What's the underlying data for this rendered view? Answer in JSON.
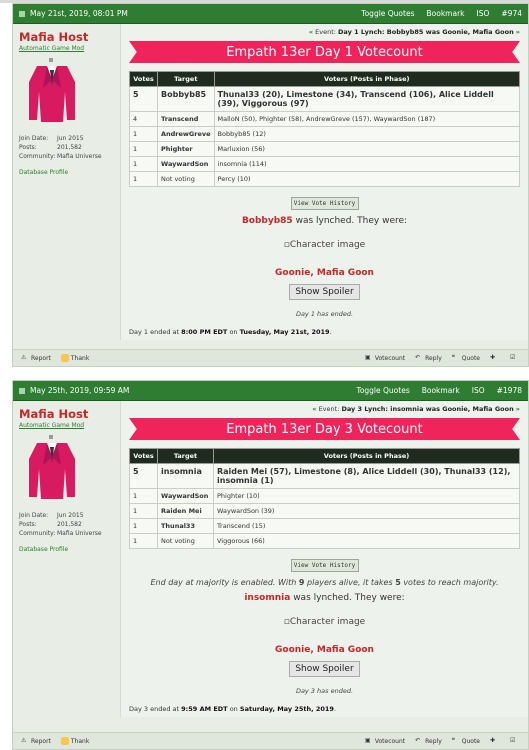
{
  "posts": [
    {
      "date": "May 21st, 2019, 08:01 PM",
      "toggle_quotes": "Toggle Quotes",
      "bookmark": "Bookmark",
      "iso": "ISO",
      "post_number": "#974",
      "user": {
        "name": "Mafia Host",
        "title": "Automatic Game Mod",
        "join_date_label": "Join Date:",
        "join_date": "Jun 2015",
        "posts_label": "Posts:",
        "posts": "201,582",
        "community_label": "Community:",
        "community": "Mafia Universe",
        "db_profile": "Database Profile"
      },
      "event_prefix": "Event:",
      "event": "Day 1 Lynch: Bobbyb85 was Goonie, Mafia Goon",
      "banner": "Empath 13er Day 1 Votecount",
      "table_headers": [
        "Votes",
        "Target",
        "Voters (Posts in Phase)"
      ],
      "rows": [
        {
          "votes": "5",
          "target": "Bobbyb85",
          "voters": "Thunal33 (20), Limestone (34), Transcend (106), Alice Liddell (39), Viggorous (97)"
        },
        {
          "votes": "4",
          "target": "Transcend",
          "voters": "MalloN (50), Phighter (58), AndrewGreve (157), WaywardSon (187)"
        },
        {
          "votes": "1",
          "target": "AndrewGreve",
          "voters": "Bobbyb85 (12)"
        },
        {
          "votes": "1",
          "target": "Phighter",
          "voters": "Marluxion (56)"
        },
        {
          "votes": "1",
          "target": "WaywardSon",
          "voters": "insomnia (114)"
        },
        {
          "votes": "1",
          "target": "Not voting",
          "voters": "Percy (10)"
        }
      ],
      "vote_history": "View Vote History",
      "lynched_name": "Bobbyb85",
      "lynched_text": "was lynched. They were:",
      "char_image_alt": "Character image",
      "faction": "Goonie, Mafia Goon",
      "spoiler": "Show Spoiler",
      "phase_ended": "Day 1 has ended.",
      "end_prefix": "Day 1 ended at",
      "end_time": "8:00 PM EDT",
      "end_on": "on",
      "end_date": "Tuesday, May 21st, 2019",
      "footer": {
        "report": "Report",
        "thank": "Thank",
        "votecount": "Votecount",
        "reply": "Reply",
        "quote": "Quote"
      }
    },
    {
      "date": "May 25th, 2019, 09:59 AM",
      "toggle_quotes": "Toggle Quotes",
      "bookmark": "Bookmark",
      "iso": "ISO",
      "post_number": "#1978",
      "user": {
        "name": "Mafia Host",
        "title": "Automatic Game Mod",
        "join_date_label": "Join Date:",
        "join_date": "Jun 2015",
        "posts_label": "Posts:",
        "posts": "201,582",
        "community_label": "Community:",
        "community": "Mafia Universe",
        "db_profile": "Database Profile"
      },
      "event_prefix": "Event:",
      "event": "Day 3 Lynch: insomnia was Goonie, Mafia Goon",
      "banner": "Empath 13er Day 3 Votecount",
      "table_headers": [
        "Votes",
        "Target",
        "Voters (Posts in Phase)"
      ],
      "rows": [
        {
          "votes": "5",
          "target": "insomnia",
          "voters": "Raiden Mei (57), Limestone (8), Alice Liddell (30), Thunal33 (12), insomnia (1)"
        },
        {
          "votes": "1",
          "target": "WaywardSon",
          "voters": "Phighter (10)"
        },
        {
          "votes": "1",
          "target": "Raiden Mei",
          "voters": "WaywardSon (39)"
        },
        {
          "votes": "1",
          "target": "Thunal33",
          "voters": "Transcend (15)"
        },
        {
          "votes": "1",
          "target": "Not voting",
          "voters": "Viggorous (66)"
        }
      ],
      "vote_history": "View Vote History",
      "majority_a": "End day at majority is enabled. With",
      "majority_alive": "9",
      "majority_b": "players alive, it takes",
      "majority_votes": "5",
      "majority_c": "votes to reach majority.",
      "lynched_name": "insomnia",
      "lynched_text": "was lynched. They were:",
      "char_image_alt": "Character image",
      "faction": "Goonie, Mafia Goon",
      "spoiler": "Show Spoiler",
      "phase_ended": "Day 3 has ended.",
      "end_prefix": "Day 3 ended at",
      "end_time": "9:59 AM EDT",
      "end_on": "on",
      "end_date": "Saturday, May 25th, 2019",
      "footer": {
        "report": "Report",
        "thank": "Thank",
        "votecount": "Votecount",
        "reply": "Reply",
        "quote": "Quote"
      }
    }
  ],
  "colors": {
    "header_green": "#2e7d32",
    "banner_pink": "#f0245a",
    "name_red": "#c62828",
    "voter_green": "#2e7d32"
  }
}
